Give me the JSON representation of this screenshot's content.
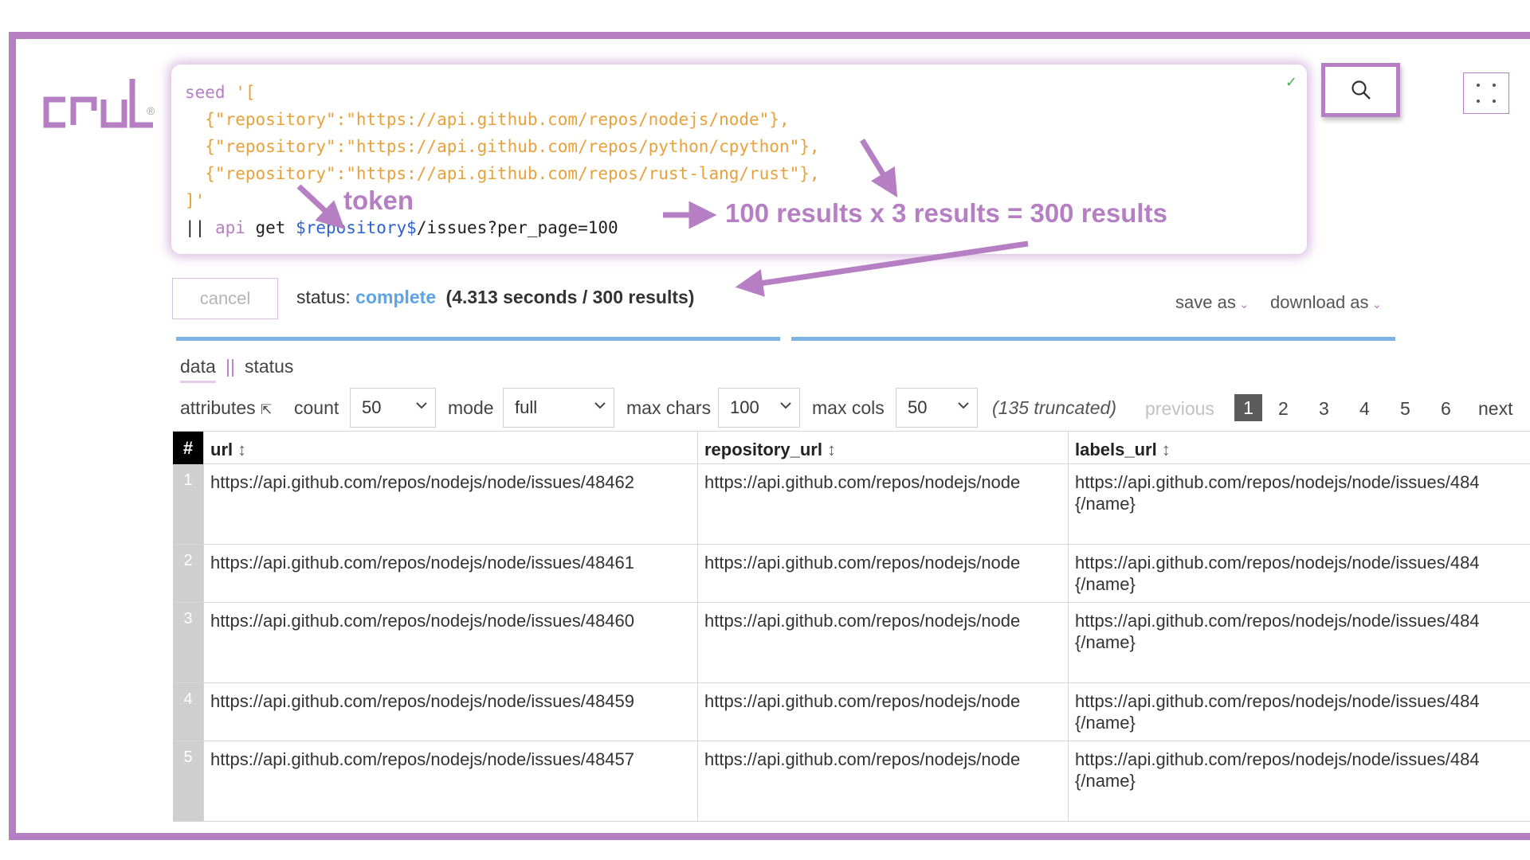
{
  "app": {
    "logo_text": "crul",
    "reg_mark": "®"
  },
  "editor": {
    "lines": [
      {
        "kw": "seed",
        "rest": " '["
      },
      {
        "rest": "  {\"repository\":\"https://api.github.com/repos/nodejs/node\"},"
      },
      {
        "rest": "  {\"repository\":\"https://api.github.com/repos/python/cpython\"},"
      },
      {
        "rest": "  {\"repository\":\"https://api.github.com/repos/rust-lang/rust\"},"
      },
      {
        "rest": "]'"
      }
    ],
    "last_line": {
      "pipe": "|| ",
      "kw": "api",
      "cmd": " get ",
      "token": "$repository$",
      "path": "/issues?per_page=100"
    },
    "valid_icon": "check-icon",
    "valid_mark": "✓"
  },
  "annotations": {
    "token": "token",
    "results": "100 results x 3 results = 300 results"
  },
  "status_row": {
    "cancel_label": "cancel",
    "status_label": "status:",
    "status_value": "complete",
    "status_stats": "(4.313 seconds / 300 results)",
    "save_as_label": "save as",
    "download_as_label": "download as"
  },
  "tabs": {
    "data": "data",
    "separator": "||",
    "status": "status"
  },
  "controls": {
    "attributes_label": "attributes",
    "count_label": "count",
    "count_value": "50",
    "mode_label": "mode",
    "mode_value": "full",
    "max_chars_label": "max chars",
    "max_chars_value": "100",
    "max_cols_label": "max cols",
    "max_cols_value": "50",
    "truncated": "(135 truncated)"
  },
  "pagination": {
    "previous": "previous",
    "pages": [
      "1",
      "2",
      "3",
      "4",
      "5",
      "6"
    ],
    "current": "1",
    "next": "next"
  },
  "table": {
    "index_header": "#",
    "columns": [
      "url",
      "repository_url",
      "labels_url"
    ],
    "sort_glyph": "↕",
    "rows": [
      {
        "index": "1",
        "url": "https://api.github.com/repos/nodejs/node/issues/48462",
        "repository_url": "https://api.github.com/repos/nodejs/node",
        "labels_url_1": "https://api.github.com/repos/nodejs/node/issues/484",
        "labels_url_2": "{/name}"
      },
      {
        "index": "2",
        "url": "https://api.github.com/repos/nodejs/node/issues/48461",
        "repository_url": "https://api.github.com/repos/nodejs/node",
        "labels_url_1": "https://api.github.com/repos/nodejs/node/issues/484",
        "labels_url_2": "{/name}"
      },
      {
        "index": "3",
        "url": "https://api.github.com/repos/nodejs/node/issues/48460",
        "repository_url": "https://api.github.com/repos/nodejs/node",
        "labels_url_1": "https://api.github.com/repos/nodejs/node/issues/484",
        "labels_url_2": "{/name}"
      },
      {
        "index": "4",
        "url": "https://api.github.com/repos/nodejs/node/issues/48459",
        "repository_url": "https://api.github.com/repos/nodejs/node",
        "labels_url_1": "https://api.github.com/repos/nodejs/node/issues/484",
        "labels_url_2": "{/name}"
      },
      {
        "index": "5",
        "url": "https://api.github.com/repos/nodejs/node/issues/48457",
        "repository_url": "https://api.github.com/repos/nodejs/node",
        "labels_url_1": "https://api.github.com/repos/nodejs/node/issues/484",
        "labels_url_2": "{/name}"
      }
    ]
  },
  "colors": {
    "brand": "#b77fc3",
    "string": "#e8a13b",
    "token": "#2c62d1",
    "status_complete": "#5da3e8",
    "progress_bar": "#7fb3e6"
  }
}
